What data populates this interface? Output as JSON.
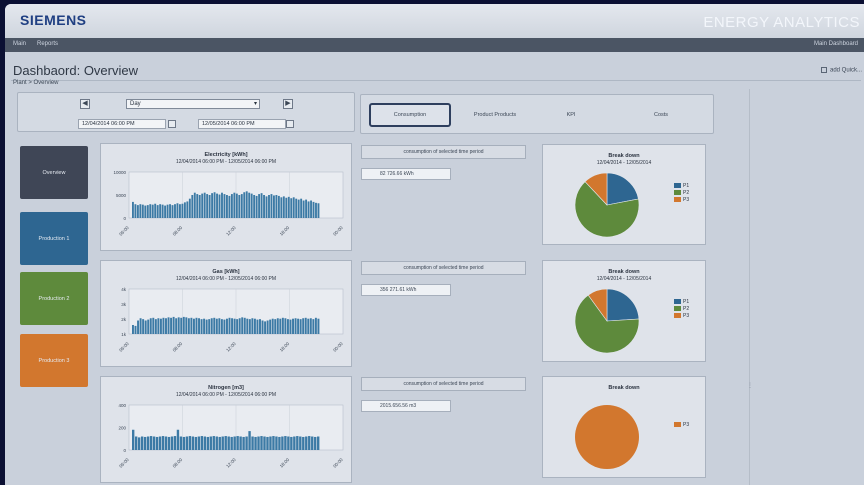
{
  "brand": {
    "logo": "SIEMENS",
    "app_title": "ENERGY ANALYTICS"
  },
  "menubar": {
    "items": [
      "Main",
      "Reports"
    ],
    "right_text": "Main Dashboard"
  },
  "page": {
    "title": "Dashbaord: Overview",
    "breadcrumb": "Plant > Overview",
    "add_quick": "add Quick..."
  },
  "filter": {
    "prev_icon": "◀",
    "next_icon": "▶",
    "period": "Day",
    "from_datetime": "12/04/2014 06:00 PM",
    "to_datetime": "12/05/2014 06:00 PM"
  },
  "tabs": [
    {
      "label": "Consumption",
      "active": true
    },
    {
      "label": "Product Products",
      "active": false
    },
    {
      "label": "KPI",
      "active": false
    },
    {
      "label": "Costs",
      "active": false
    }
  ],
  "tiles": {
    "overview": "Overview",
    "p1": "Production 1",
    "p2": "Production 2",
    "p3": "Production 3"
  },
  "colors": {
    "p1": "#2e6691",
    "p2": "#5e8a3c",
    "p3": "#d2772e",
    "bar": "#3c7aa5"
  },
  "charts": [
    {
      "title": "Electricity [kWh]",
      "subtitle": "12/04/2014 06:00 PM - 12/05/2014 06:00 PM",
      "yticks": [
        "10000",
        "5000",
        "0"
      ],
      "xticks": [
        "06:00",
        "08:00",
        "12:00",
        "18:00",
        "00:00"
      ],
      "values": [
        0.35,
        0.3,
        0.28,
        0.3,
        0.29,
        0.27,
        0.28,
        0.3,
        0.29,
        0.31,
        0.28,
        0.3,
        0.29,
        0.27,
        0.29,
        0.3,
        0.28,
        0.3,
        0.32,
        0.3,
        0.31,
        0.34,
        0.36,
        0.42,
        0.5,
        0.55,
        0.52,
        0.5,
        0.53,
        0.55,
        0.52,
        0.5,
        0.54,
        0.56,
        0.53,
        0.51,
        0.55,
        0.52,
        0.5,
        0.48,
        0.52,
        0.55,
        0.53,
        0.5,
        0.52,
        0.56,
        0.58,
        0.55,
        0.53,
        0.5,
        0.48,
        0.52,
        0.54,
        0.5,
        0.47,
        0.5,
        0.52,
        0.49,
        0.5,
        0.48,
        0.45,
        0.47,
        0.44,
        0.46,
        0.43,
        0.45,
        0.42,
        0.4,
        0.42,
        0.38,
        0.4,
        0.36,
        0.38,
        0.35,
        0.33,
        0.32
      ]
    },
    {
      "title": "Gas [kWh]",
      "subtitle": "12/04/2014 06:00 PM - 12/05/2014 06:00 PM",
      "yticks": [
        "4k",
        "3k",
        "2k",
        "1k"
      ],
      "xticks": [
        "06:00",
        "08:00",
        "12:00",
        "18:00",
        "00:00"
      ],
      "values": [
        0.2,
        0.18,
        0.3,
        0.35,
        0.33,
        0.3,
        0.32,
        0.35,
        0.36,
        0.33,
        0.35,
        0.34,
        0.36,
        0.35,
        0.37,
        0.36,
        0.38,
        0.35,
        0.37,
        0.36,
        0.38,
        0.37,
        0.35,
        0.36,
        0.34,
        0.36,
        0.35,
        0.33,
        0.34,
        0.32,
        0.33,
        0.35,
        0.36,
        0.34,
        0.35,
        0.33,
        0.32,
        0.34,
        0.36,
        0.35,
        0.34,
        0.33,
        0.35,
        0.37,
        0.36,
        0.34,
        0.33,
        0.35,
        0.34,
        0.32,
        0.33,
        0.3,
        0.28,
        0.3,
        0.32,
        0.34,
        0.33,
        0.35,
        0.34,
        0.36,
        0.35,
        0.33,
        0.32,
        0.34,
        0.35,
        0.34,
        0.33,
        0.35,
        0.36,
        0.34,
        0.35,
        0.33,
        0.36,
        0.34
      ]
    },
    {
      "title": "Nitrogen [m3]",
      "subtitle": "12/04/2014 06:00 PM - 12/05/2014 06:00 PM",
      "yticks": [
        "400",
        "200",
        "0"
      ],
      "xticks": [
        "06:00",
        "08:00",
        "12:00",
        "18:00",
        "00:00"
      ],
      "values": [
        0.45,
        0.3,
        0.28,
        0.3,
        0.29,
        0.3,
        0.31,
        0.3,
        0.29,
        0.3,
        0.31,
        0.3,
        0.29,
        0.3,
        0.31,
        0.45,
        0.3,
        0.29,
        0.3,
        0.31,
        0.3,
        0.29,
        0.3,
        0.31,
        0.3,
        0.29,
        0.3,
        0.31,
        0.3,
        0.29,
        0.3,
        0.31,
        0.3,
        0.29,
        0.3,
        0.31,
        0.3,
        0.29,
        0.3,
        0.42,
        0.3,
        0.29,
        0.3,
        0.31,
        0.3,
        0.29,
        0.3,
        0.31,
        0.3,
        0.29,
        0.3,
        0.31,
        0.3,
        0.29,
        0.3,
        0.31,
        0.3,
        0.29,
        0.3,
        0.31,
        0.3,
        0.29,
        0.3
      ]
    }
  ],
  "consumption": [
    {
      "label": "consumption of selected time period",
      "value": "82 726.66 kWh"
    },
    {
      "label": "consumption of selected time period",
      "value": "356 271.61 kWh"
    },
    {
      "label": "consumption of selected time period",
      "value": "2015.656.56 m3"
    }
  ],
  "pies": [
    {
      "title": "Break down",
      "subtitle": "12/04/2014 - 12/05/2014",
      "slices": [
        {
          "name": "P1",
          "value": 0.22,
          "color": "#2e6691"
        },
        {
          "name": "P2",
          "value": 0.66,
          "color": "#5e8a3c"
        },
        {
          "name": "P3",
          "value": 0.12,
          "color": "#d2772e"
        }
      ]
    },
    {
      "title": "Break down",
      "subtitle": "12/04/2014 - 12/05/2014",
      "slices": [
        {
          "name": "P1",
          "value": 0.24,
          "color": "#2e6691"
        },
        {
          "name": "P2",
          "value": 0.66,
          "color": "#5e8a3c"
        },
        {
          "name": "P3",
          "value": 0.1,
          "color": "#d2772e"
        }
      ]
    },
    {
      "title": "Break down",
      "subtitle": "",
      "slices": [
        {
          "name": "P3",
          "value": 1.0,
          "color": "#d2772e"
        }
      ]
    }
  ]
}
